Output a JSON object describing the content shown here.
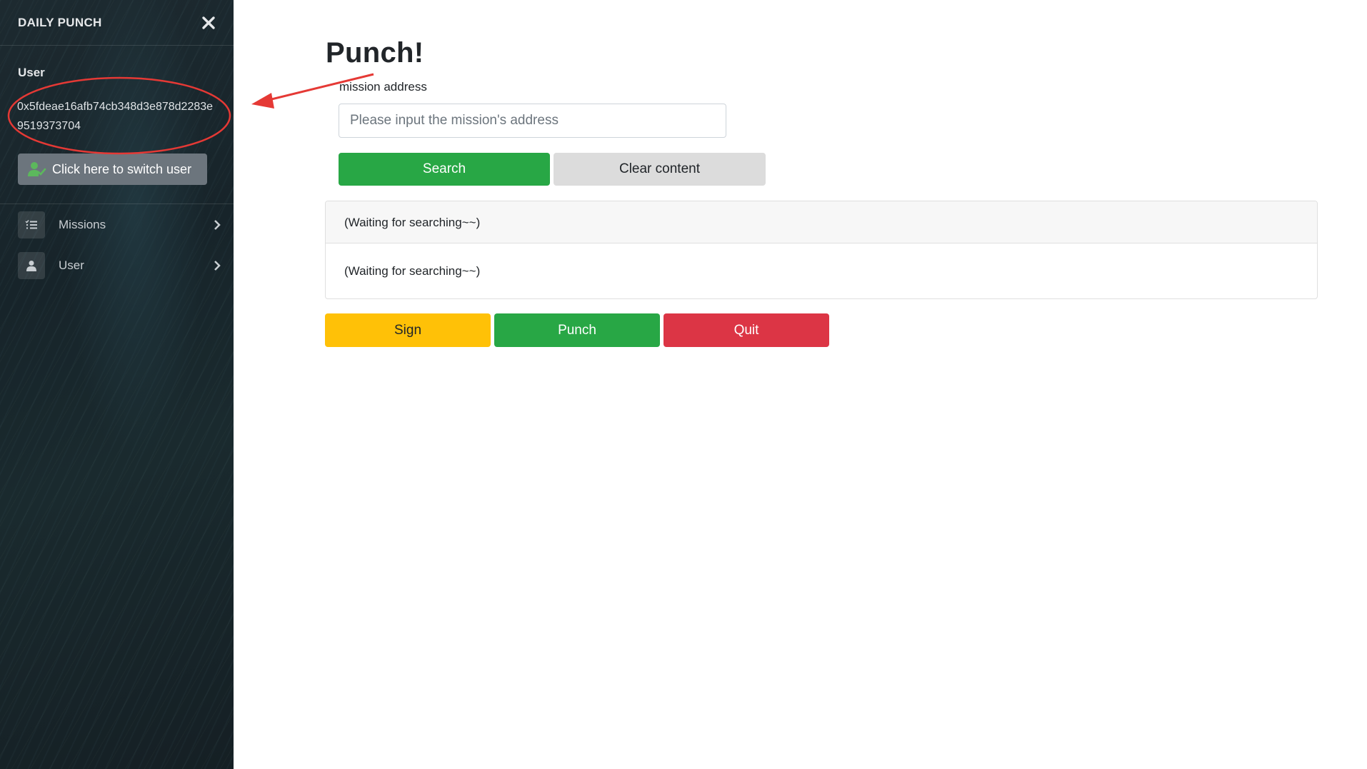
{
  "sidebar": {
    "brand": "DAILY PUNCH",
    "user_heading": "User",
    "user_address": "0x5fdeae16afb74cb348d3e878d2283e9519373704",
    "switch_user_label": "Click here to switch user",
    "nav": [
      {
        "label": "Missions",
        "icon": "list-icon"
      },
      {
        "label": "User",
        "icon": "person-icon"
      }
    ]
  },
  "main": {
    "title": "Punch!",
    "mission_label": "mission address",
    "mission_input": {
      "value": "",
      "placeholder": "Please input the mission's address"
    },
    "search_label": "Search",
    "clear_label": "Clear content",
    "result_header": "(Waiting for searching~~)",
    "result_body": "(Waiting for searching~~)",
    "sign_label": "Sign",
    "punch_label": "Punch",
    "quit_label": "Quit"
  },
  "colors": {
    "success": "#28a745",
    "warning": "#ffc107",
    "danger": "#dc3545",
    "secondary": "#6c757d",
    "annotation": "#e53935"
  }
}
